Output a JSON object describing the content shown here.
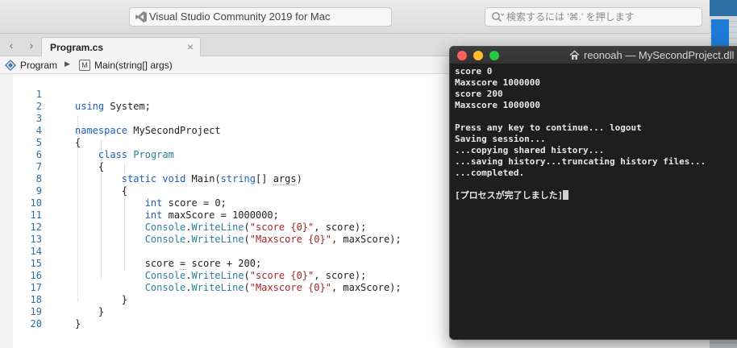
{
  "toolbar": {
    "status_text": "Visual Studio Community 2019 for Mac",
    "search_placeholder": "検索するには '⌘.' を押します"
  },
  "tabs": [
    {
      "label": "Program.cs"
    }
  ],
  "breadcrumb": {
    "item1": "Program",
    "item2": "Main(string[] args)"
  },
  "editor": {
    "line_numbers": [
      "1",
      "2",
      "3",
      "4",
      "5",
      "6",
      "7",
      "8",
      "9",
      "10",
      "11",
      "12",
      "13",
      "14",
      "15",
      "16",
      "17",
      "18",
      "19",
      "20"
    ],
    "lines": [
      "using System;",
      "",
      "namespace MySecondProject",
      "{",
      "    class Program",
      "    {",
      "        static void Main(string[] args)",
      "        {",
      "            int score = 0;",
      "            int maxScore = 1000000;",
      "            Console.WriteLine(\"score {0}\", score);",
      "            Console.WriteLine(\"Maxscore {0}\", maxScore);",
      "",
      "            score = score + 200;",
      "            Console.WriteLine(\"score {0}\", score);",
      "            Console.WriteLine(\"Maxscore {0}\", maxScore);",
      "        }",
      "    }",
      "}",
      ""
    ]
  },
  "terminal": {
    "title": "reonoah — MySecondProject.dll",
    "lines": [
      "score 0",
      "Maxscore 1000000",
      "score 200",
      "Maxscore 1000000",
      "",
      "Press any key to continue... logout",
      "Saving session...",
      "...copying shared history...",
      "...saving history...truncating history files...",
      "...completed.",
      "",
      "[プロセスが完了しました]"
    ]
  },
  "colors": {
    "keyword": "#1f5fc0",
    "type": "#2d7f97",
    "string": "#a0262a",
    "line_number": "#2b6fa3",
    "terminal_bg": "#1e1e1e"
  }
}
